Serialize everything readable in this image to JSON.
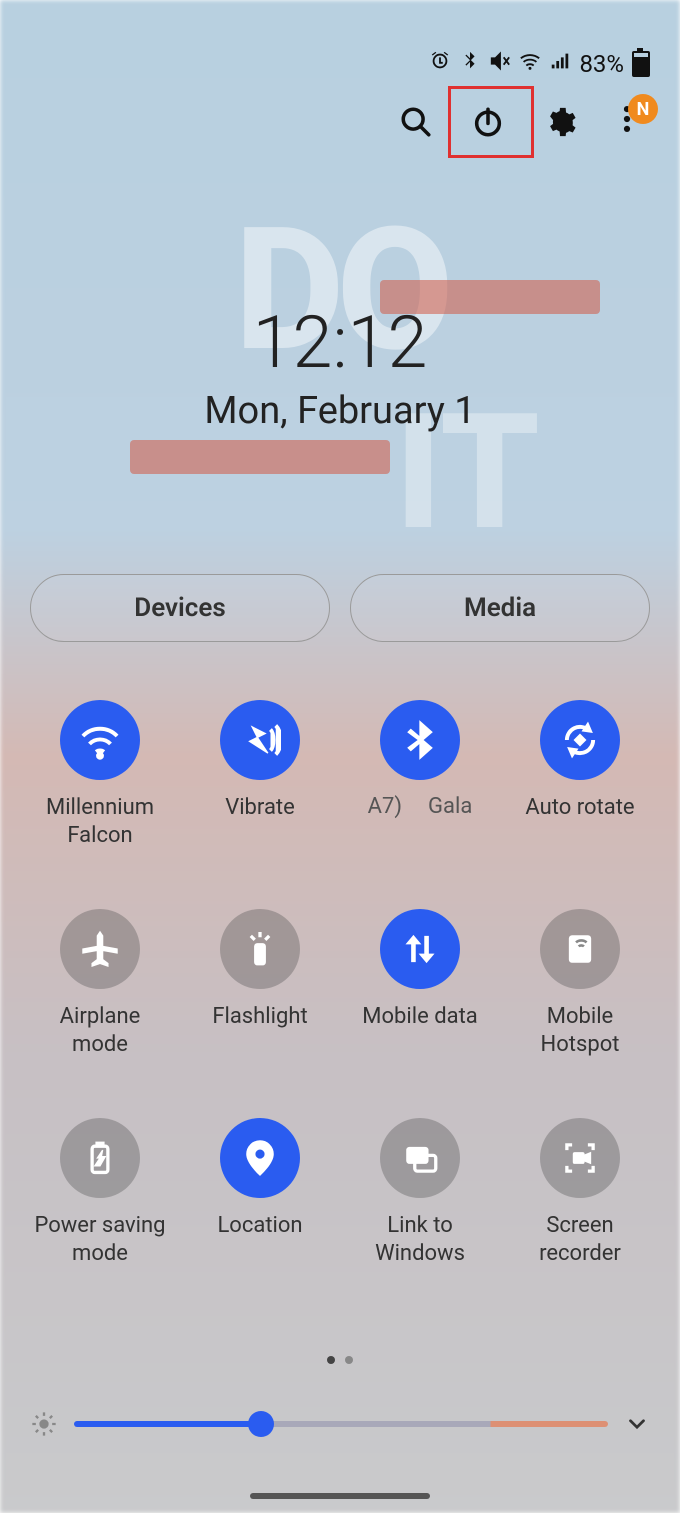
{
  "status": {
    "battery_pct": "83%",
    "icons": [
      "alarm",
      "bluetooth",
      "vibrate",
      "wifi",
      "signal"
    ]
  },
  "toolbar": {
    "search": "Search",
    "power": "Power",
    "settings": "Settings",
    "more": "More",
    "avatar_letter": "N"
  },
  "clock": {
    "time": "12:12",
    "date": "Mon, February 1"
  },
  "pills": {
    "devices": "Devices",
    "media": "Media"
  },
  "tiles": [
    {
      "id": "wifi",
      "label": "Millennium Falcon",
      "on": true,
      "icon": "wifi"
    },
    {
      "id": "vibrate",
      "label": "Vibrate",
      "on": true,
      "icon": "vibrate"
    },
    {
      "id": "bluetooth",
      "label": "",
      "on": true,
      "icon": "bt",
      "sub_left": "A7)",
      "sub_right": "Gala"
    },
    {
      "id": "autorotate",
      "label": "Auto rotate",
      "on": true,
      "icon": "rotate"
    },
    {
      "id": "airplane",
      "label": "Airplane mode",
      "on": false,
      "icon": "plane"
    },
    {
      "id": "flashlight",
      "label": "Flashlight",
      "on": false,
      "icon": "torch"
    },
    {
      "id": "mobiledata",
      "label": "Mobile data",
      "on": true,
      "icon": "data"
    },
    {
      "id": "hotspot",
      "label": "Mobile Hotspot",
      "on": false,
      "icon": "hotspot"
    },
    {
      "id": "powersave",
      "label": "Power saving mode",
      "on": false,
      "icon": "battery"
    },
    {
      "id": "location",
      "label": "Location",
      "on": true,
      "icon": "pin"
    },
    {
      "id": "link",
      "label": "Link to Windows",
      "on": false,
      "icon": "cast"
    },
    {
      "id": "recorder",
      "label": "Screen recorder",
      "on": false,
      "icon": "rec"
    }
  ],
  "brightness": {
    "value_pct": 35
  },
  "pager": {
    "pages": 2,
    "active": 0
  },
  "highlight": {
    "target": "power-button"
  }
}
